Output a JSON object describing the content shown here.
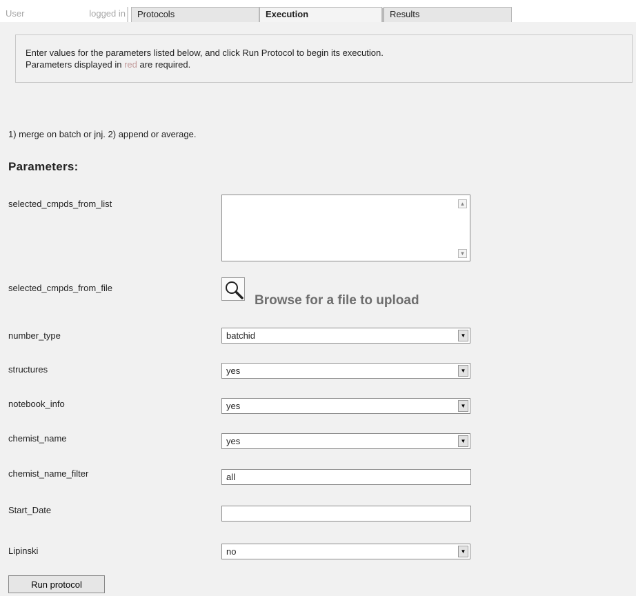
{
  "header": {
    "user_label": "User",
    "logged_in_label": "logged in",
    "tabs": [
      {
        "label": "Protocols"
      },
      {
        "label": "Execution"
      },
      {
        "label": "Results"
      }
    ]
  },
  "info": {
    "line1": "Enter values for the parameters listed below, and click Run Protocol to begin its execution.",
    "line2_before": "Parameters displayed in ",
    "line2_red": "red",
    "line2_after": " are required."
  },
  "description": "1) merge on batch or jnj. 2) append or average.",
  "params_title": "Parameters:",
  "params": {
    "selected_cmpds_from_list": {
      "label": "selected_cmpds_from_list",
      "value": ""
    },
    "selected_cmpds_from_file": {
      "label": "selected_cmpds_from_file",
      "button": "Browse for a file to upload"
    },
    "number_type": {
      "label": "number_type",
      "value": "batchid"
    },
    "structures": {
      "label": "structures",
      "value": "yes"
    },
    "notebook_info": {
      "label": "notebook_info",
      "value": "yes"
    },
    "chemist_name": {
      "label": "chemist_name",
      "value": "yes"
    },
    "chemist_name_filter": {
      "label": "chemist_name_filter",
      "value": "all"
    },
    "start_date": {
      "label": "Start_Date",
      "value": ""
    },
    "lipinski": {
      "label": "Lipinski",
      "value": "no"
    }
  },
  "run_button": "Run protocol",
  "icons": {
    "browse": "magnifier-icon",
    "dropdown": "triangle-down-icon",
    "scroll_up": "triangle-up-icon",
    "scroll_down": "triangle-down-icon"
  }
}
